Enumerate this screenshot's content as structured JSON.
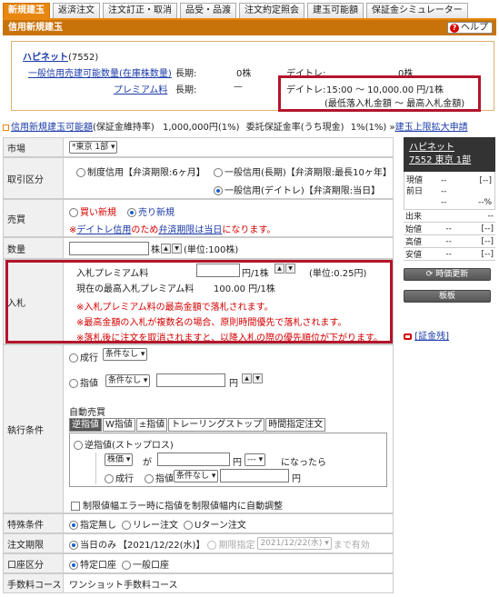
{
  "tabs": [
    "新規建玉",
    "返済注文",
    "注文訂正・取消",
    "品受・品渡",
    "注文約定照会",
    "建玉可能額",
    "保証金シミュレーター"
  ],
  "header": {
    "title": "信用新規建玉",
    "help_label": "ヘルプ"
  },
  "stock": {
    "name": "ハピネット",
    "code": "(7552)",
    "sell_qty_link": "一般信用売建可能数量(在庫株数量)",
    "long_label": "長期:",
    "long_qty": "0株",
    "day_label": "デイトレ:",
    "day_qty": "0株",
    "premium_link": "プレミアム料",
    "premium_long_label": "長期:",
    "premium_long_value": "—",
    "premium_day_label": "デイトレ:",
    "premium_day_value": "15:00 〜 10,000.00 円/1株",
    "premium_day_note": "(最低落入札金額 〜 最高入札金額)"
  },
  "strip": {
    "link1": "信用新規建玉可能額",
    "text1": "(保証金維持率)",
    "amount": "1,000,000円(1%)",
    "text2": "委託保証金率(うち現金)",
    "text3": "1%(1%)",
    "link2": "建玉上限拡大申請"
  },
  "form": {
    "market": {
      "label": "市場",
      "value": "*東京 1部"
    },
    "trade_type": {
      "label": "取引区分",
      "opt1": "制度信用【弁済期限:6ヶ月】",
      "opt2": "一般信用(長期)【弁済期限:最長10ヶ年】",
      "opt3": "一般信用(デイトレ)【弁済期限:当日】"
    },
    "buy_sell": {
      "label": "売買",
      "opt_buy": "買い新規",
      "opt_sell": "売り新規",
      "note_prefix": "※",
      "note_link1": "デイトレ信用",
      "note_mid": "のため",
      "note_link2": "弁済期限は当日",
      "note_suffix": "になります。"
    },
    "quantity": {
      "label": "数量",
      "unit": "株",
      "unit_note": "(単位:100株)"
    },
    "bid": {
      "label": "入札",
      "premium_label": "入札プレミアム料",
      "premium_unit": "円/1株",
      "unit_note": "(単位:0.25円)",
      "max_label": "現在の最高入札プレミアム料",
      "max_value": "100.00 円/1株",
      "note1": "※入札プレミアム料の最高金額で落札されます。",
      "note2": "※最高金額の入札が複数名の場合、原則時間優先で落札されます。",
      "note3": "※落札後に注文を取消されますと、以降入札の際の優先順位が下がります。"
    },
    "exec": {
      "label": "執行条件",
      "market_order": "成行",
      "cond_none": "条件なし",
      "limit_order": "指値",
      "yen": "円",
      "auto_label": "自動売買",
      "subtabs": [
        "逆指値",
        "W指値",
        "±指値",
        "トレーリングストップ",
        "時間指定注文"
      ],
      "stop_label": "逆指値(ストップロス)",
      "stop_price": "株価",
      "ga": "が",
      "dash": "---",
      "became": "になったら",
      "cb_label": "制限値幅エラー時に指値を制限値幅内に自動調整"
    },
    "special": {
      "label": "特殊条件",
      "opt1": "指定無し",
      "opt2": "リレー注文",
      "opt3": "Uターン注文"
    },
    "expiry": {
      "label": "注文期限",
      "opt1": "当日のみ",
      "date1": "【2021/12/22(水)】",
      "opt2": "期限指定",
      "date2": "2021/12/22(水)",
      "until": "まで有効"
    },
    "account": {
      "label": "口座区分",
      "opt1": "特定口座",
      "opt2": "一般口座"
    },
    "fee": {
      "label": "手数料コース",
      "value": "ワンショット手数料コース"
    }
  },
  "right_panel": {
    "name": "ハピネット",
    "sub": "7552 東京 1部",
    "rows": [
      [
        "現値",
        "--",
        "[--]"
      ],
      [
        "前日",
        "--",
        ""
      ],
      [
        "",
        "--",
        "--%"
      ]
    ],
    "table": [
      [
        "出来",
        "",
        "--"
      ],
      [
        "始値",
        "--",
        "[--]"
      ],
      [
        "高値",
        "--",
        "[--]"
      ],
      [
        "安値",
        "--",
        "[--]"
      ]
    ],
    "btn_refresh": "時価更新",
    "btn_board": "板板",
    "margin_link": "[証金残]"
  }
}
